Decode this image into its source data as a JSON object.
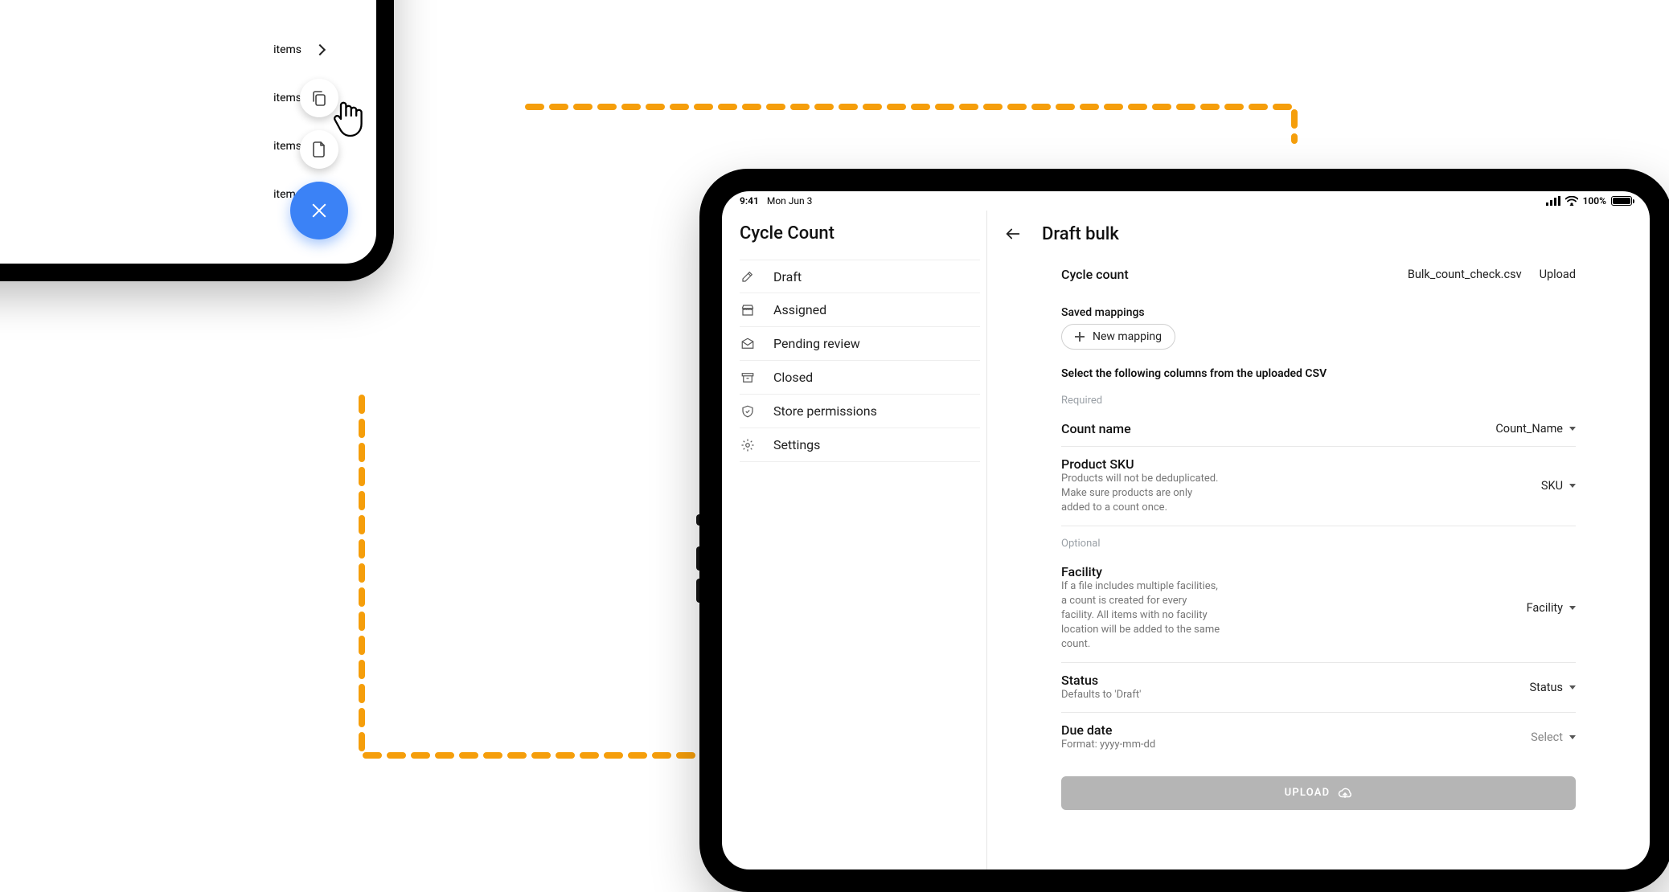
{
  "left_tablet": {
    "item_label": "items"
  },
  "status_bar": {
    "time": "9:41",
    "date": "Mon Jun 3",
    "battery": "100%"
  },
  "sidebar": {
    "title": "Cycle Count",
    "items": [
      {
        "label": "Draft"
      },
      {
        "label": "Assigned"
      },
      {
        "label": "Pending review"
      },
      {
        "label": "Closed"
      },
      {
        "label": "Store permissions"
      },
      {
        "label": "Settings"
      }
    ]
  },
  "main": {
    "header_title": "Draft bulk",
    "cycle_count_label": "Cycle count",
    "uploaded_file": "Bulk_count_check.csv",
    "upload_link": "Upload",
    "saved_mappings_label": "Saved mappings",
    "new_mapping_label": "New mapping",
    "instruction": "Select the following columns from the uploaded CSV",
    "required_label": "Required",
    "optional_label": "Optional",
    "rows": {
      "count_name": {
        "title": "Count name",
        "value": "Count_Name"
      },
      "product_sku": {
        "title": "Product SKU",
        "sub": "Products will not be deduplicated. Make sure products are only added to a count once.",
        "value": "SKU"
      },
      "facility": {
        "title": "Facility",
        "sub": "If a file includes multiple facilities, a count is created for every facility. All items with no facility location will be added to the same count.",
        "value": "Facility"
      },
      "status": {
        "title": "Status",
        "sub": "Defaults to 'Draft'",
        "value": "Status"
      },
      "due_date": {
        "title": "Due date",
        "sub": "Format: yyyy-mm-dd",
        "value": "Select"
      }
    },
    "upload_button": "UPLOAD"
  }
}
